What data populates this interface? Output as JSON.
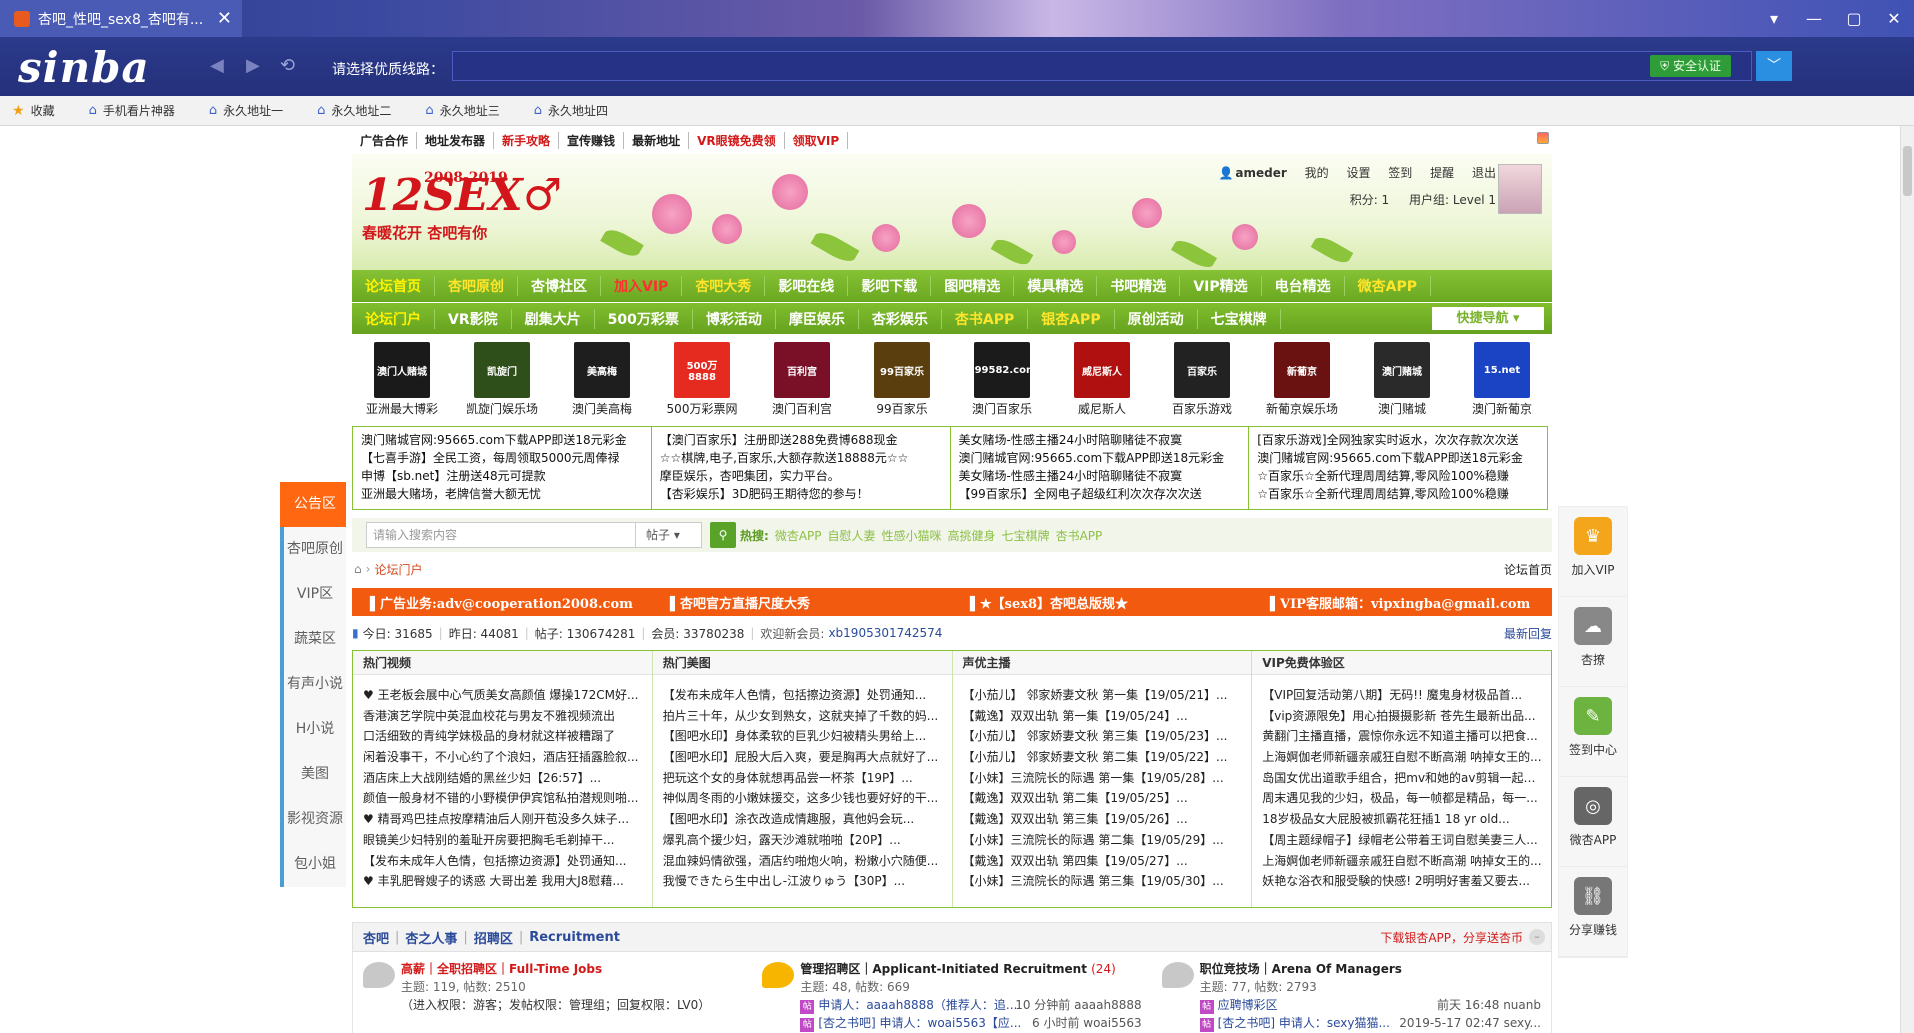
{
  "browser": {
    "tab_title": "杏吧_性吧_sex8_杏吧有...",
    "tab_close": "✕",
    "window_controls": [
      "▾",
      "—",
      "▢",
      "✕"
    ],
    "logo": "sinba",
    "line_label": "请选择优质线路：",
    "url": "",
    "secure_label": "安全认证",
    "favorites": [
      {
        "label": "收藏"
      },
      {
        "label": "手机看片神器"
      },
      {
        "label": "永久地址一"
      },
      {
        "label": "永久地址二"
      },
      {
        "label": "永久地址三"
      },
      {
        "label": "永久地址四"
      }
    ]
  },
  "top_links": [
    {
      "label": "广告合作",
      "style": "dark"
    },
    {
      "label": "地址发布器",
      "style": "dark"
    },
    {
      "label": "新手攻略",
      "style": "red"
    },
    {
      "label": "宣传赚钱",
      "style": "dark"
    },
    {
      "label": "最新地址",
      "style": "dark"
    },
    {
      "label": "VR眼镜免费领",
      "style": "red"
    },
    {
      "label": "领取VIP",
      "style": "red"
    }
  ],
  "banner": {
    "logo_main": "12SEX♂",
    "logo_years": "2008-2019",
    "logo_slogan": "春暖花开 杏吧有你",
    "user": {
      "username": "ameder",
      "links": [
        "我的",
        "设置",
        "签到",
        "提醒",
        "退出"
      ],
      "points": "积分: 1",
      "group": "用户组: Level 1"
    }
  },
  "nav1": [
    {
      "label": "论坛首页",
      "style": "active"
    },
    {
      "label": "杏吧原创",
      "style": "yellow"
    },
    {
      "label": "杏博社区",
      "style": ""
    },
    {
      "label": "加入VIP",
      "style": "red"
    },
    {
      "label": "杏吧大秀",
      "style": "yellow"
    },
    {
      "label": "影吧在线",
      "style": ""
    },
    {
      "label": "影吧下载",
      "style": ""
    },
    {
      "label": "图吧精选",
      "style": ""
    },
    {
      "label": "模具精选",
      "style": ""
    },
    {
      "label": "书吧精选",
      "style": ""
    },
    {
      "label": "VIP精选",
      "style": ""
    },
    {
      "label": "电台精选",
      "style": ""
    },
    {
      "label": "微杏APP",
      "style": "yellow"
    }
  ],
  "nav2": [
    {
      "label": "论坛门户",
      "style": "active"
    },
    {
      "label": "VR影院",
      "style": ""
    },
    {
      "label": "剧集大片",
      "style": ""
    },
    {
      "label": "500万彩票",
      "style": ""
    },
    {
      "label": "博彩活动",
      "style": ""
    },
    {
      "label": "摩臣娱乐",
      "style": ""
    },
    {
      "label": "杏彩娱乐",
      "style": ""
    },
    {
      "label": "杏书APP",
      "style": "yellow"
    },
    {
      "label": "银杏APP",
      "style": "yellow"
    },
    {
      "label": "原创活动",
      "style": ""
    },
    {
      "label": "七宝棋牌",
      "style": ""
    }
  ],
  "quick_nav": "快捷导航 ▾",
  "logo_tiles": [
    {
      "label": "亚洲最大博彩",
      "text": "澳门人赌城",
      "color": "#1a1a1a"
    },
    {
      "label": "凯旋门娱乐场",
      "text": "凯旋门",
      "color": "#2f4f1a"
    },
    {
      "label": "澳门美高梅",
      "text": "美高梅",
      "color": "#1e1e1e"
    },
    {
      "label": "500万彩票网",
      "text": "500万 8888",
      "color": "#e52a20"
    },
    {
      "label": "澳门百利宫",
      "text": "百利宫",
      "color": "#7a1027"
    },
    {
      "label": "99百家乐",
      "text": "99百家乐",
      "color": "#5a3e0e"
    },
    {
      "label": "澳门百家乐",
      "text": "999582.com",
      "color": "#1b1b1b"
    },
    {
      "label": "威尼斯人",
      "text": "威尼斯人",
      "color": "#b01010"
    },
    {
      "label": "百家乐游戏",
      "text": "百家乐",
      "color": "#222"
    },
    {
      "label": "新葡京娱乐场",
      "text": "新葡京",
      "color": "#6a1212"
    },
    {
      "label": "澳门赌城",
      "text": "澳门赌城",
      "color": "#2a2a2a"
    },
    {
      "label": "澳门新葡京",
      "text": "15.net",
      "color": "#1b44c4"
    }
  ],
  "ad_cols": [
    [
      "澳门赌城官网:95665.com下载APP即送18元彩金",
      "【七喜手游】全民工资，每周领取5000元周俸禄",
      "申博【sb.net】注册送48元可提款",
      "亚洲最大赌场，老牌信誉大额无忧"
    ],
    [
      "【澳门百家乐】注册即送288免费博688现金",
      "☆☆棋牌,电子,百家乐,大额存款送18888元☆☆",
      "摩臣娱乐，杏吧集团，实力平台。",
      "【杏彩娱乐】3D肥码王期待您的参与！"
    ],
    [
      "美女赌场-性感主播24小时陪聊赌徒不寂寞",
      "澳门赌城官网:95665.com下载APP即送18元彩金",
      "美女赌场-性感主播24小时陪聊赌徒不寂寞",
      "【99百家乐】全网电子超级红利次次存次次送"
    ],
    [
      "[百家乐游戏]全网独家实时返水，次次存款次次送",
      "澳门赌城官网:95665.com下载APP即送18元彩金",
      "☆百家乐☆全新代理周周结算,零风险100%稳赚",
      "☆百家乐☆全新代理周周结算,零风险100%稳赚"
    ]
  ],
  "left_side": [
    "公告区",
    "杏吧原创",
    "VIP区",
    "蔬菜区",
    "有声小说",
    "H小说",
    "美图",
    "影视资源",
    "包小姐"
  ],
  "search": {
    "placeholder": "请输入搜索内容",
    "select": "帖子 ▾",
    "hot_label": "热搜:",
    "hot_links": [
      "微杏APP",
      "自慰人妻",
      "性感小猫咪",
      "高挑健身",
      "七宝棋牌",
      "杏书APP"
    ]
  },
  "crumb": {
    "current": "论坛门户",
    "right": "论坛首页"
  },
  "orange_bar": [
    "广告业务:adv@cooperation2008.com",
    "杏吧官方直播尺度大秀",
    "★【sex8】杏吧总版规★",
    "VIP客服邮箱：vipxingba@gmail.com"
  ],
  "stats": {
    "today": "今日: 31685",
    "yesterday": "昨日: 44081",
    "posts": "帖子: 130674281",
    "members": "会员: 33780238",
    "newest_label": "欢迎新会员:",
    "newest": "xb1905301742574",
    "latest_reply": "最新回复"
  },
  "grid": [
    {
      "head": "热门视频",
      "items": [
        "♥ 王老板会展中心气质美女高颜值 爆操172CM好...",
        "香港演艺学院中英混血校花与男友不雅视频流出",
        "口活细致的青纯学妹极品的身材就这样被糟蹋了",
        "闲着没事干，不小心约了个浪妇，酒店狂插露脸叙...",
        "酒店床上大战刚结婚的黑丝少妇【26:57】...",
        "颜值一般身材不错的小野模伊伊宾馆私拍潜规则啪...",
        "♥ 精哥鸡巴挂点按摩精油后人刚开苞没多久妹子...",
        "眼镜美少妇特别的羞耻开房要把胸毛毛剃掉干...",
        "【发布未成年人色情，包括擦边资源】处罚通知...",
        "♥ 丰乳肥臀嫂子的诱惑 大哥出差 我用大J8慰藉..."
      ]
    },
    {
      "head": "热门美图",
      "items": [
        "【发布未成年人色情，包括擦边资源】处罚通知...",
        "拍片三十年，从少女到熟女，这就夹掉了千数的妈...",
        "【图吧水印】身体柔软的巨乳少妇被精头男给上...",
        "【图吧水印】屁股大后入爽，要是胸再大点就好了...",
        "把玩这个女的身体就想再品尝一杯茶【19P】...",
        "神似周冬雨的小嫩妹援交，这多少钱也要好好的干...",
        "【图吧水印】涂衣改造成情趣服，真他妈会玩...",
        "爆乳高个援少妇，露天沙滩就啪啪【20P】...",
        "混血辣妈情欲强，酒店约啪炮火响，粉嫩小穴随便...",
        "我慢できたら生中出し-江波りゅう【30P】..."
      ]
    },
    {
      "head": "声优主播",
      "items": [
        "【小茄儿】 邻家娇妻文秋 第一集【19/05/21】...",
        "【戴逸】双双出轨 第一集【19/05/24】...",
        "【小茄儿】 邻家娇妻文秋 第三集【19/05/23】...",
        "【小茄儿】 邻家娇妻文秋 第二集【19/05/22】...",
        "【小妹】三流院长的际遇 第一集【19/05/28】...",
        "【戴逸】双双出轨 第二集【19/05/25】...",
        "【戴逸】双双出轨 第三集【19/05/26】...",
        "【小妹】三流院长的际遇 第二集【19/05/29】...",
        "【戴逸】双双出轨 第四集【19/05/27】...",
        "【小妹】三流院长的际遇 第三集【19/05/30】..."
      ]
    },
    {
      "head": "VIP免费体验区",
      "items": [
        "【VIP回复活动第八期】无码!! 魔鬼身材极品首...",
        "【vip资源限免】用心拍摄摄影新 苍先生最新出品...",
        "黄翻门主播直播，震惊你永远不知道主播可以把食...",
        "上海婀伽老师新疆亲戚狂自慰不断高潮 呐掉女王的...",
        "岛国女优出道歌手组合，把mv和她的av剪辑一起太...",
        "周末遇见我的少妇，极品，每一帧都是精品，每一...",
        "18岁极品女大屁股被抓霸花狂插1 18 yr old...",
        "【周主题绿帽子】绿帽老公带着王词自慰美妻三人...",
        "上海婀伽老师新疆亲戚狂自慰不断高潮 呐掉女王的...",
        "妖艳な浴衣和服受験的快感! 2明明好害羞又要去..."
      ]
    }
  ],
  "forum_header": {
    "crumbs": [
      "杏吧",
      "杏之人事",
      "招聘区",
      "Recruitment"
    ],
    "right": "下载银杏APP，分享送杏币"
  },
  "forum_cells": [
    {
      "name_red": "高薪｜全职招聘区｜Full-Time Jobs",
      "name": "",
      "count": "",
      "meta": "主题: 119, 帖数: 2510",
      "sub": "（进入权限：游客；发帖权限：管理组；回复权限：LV0）",
      "sub_time": "",
      "sub2": "",
      "sub2_time": ""
    },
    {
      "name_red": "",
      "name": "管理招聘区｜Applicant-Initiated Recruitment",
      "count": "(24)",
      "meta": "主题: 48, 帖数: 669",
      "sub": "申请人：aaaah8888（推荐人：追...",
      "sub_time": "10 分钟前 aaaah8888",
      "sub2": "[杏之书吧] 申请人：woai5563【应...",
      "sub2_time": "6 小时前 woai5563"
    },
    {
      "name_red": "",
      "name": "职位竞技场｜Arena Of Managers",
      "count": "",
      "meta": "主题: 77, 帖数: 2793",
      "sub": "应聘博彩区",
      "sub_time": "前天 16:48 nuanb",
      "sub2": "[杏之书吧] 申请人：sexy猫猫...",
      "sub2_time": "2019-5-17 02:47 sexy..."
    }
  ],
  "right_side": [
    "加入VIP",
    "杏撩",
    "签到中心",
    "微杏APP",
    "分享赚钱"
  ]
}
